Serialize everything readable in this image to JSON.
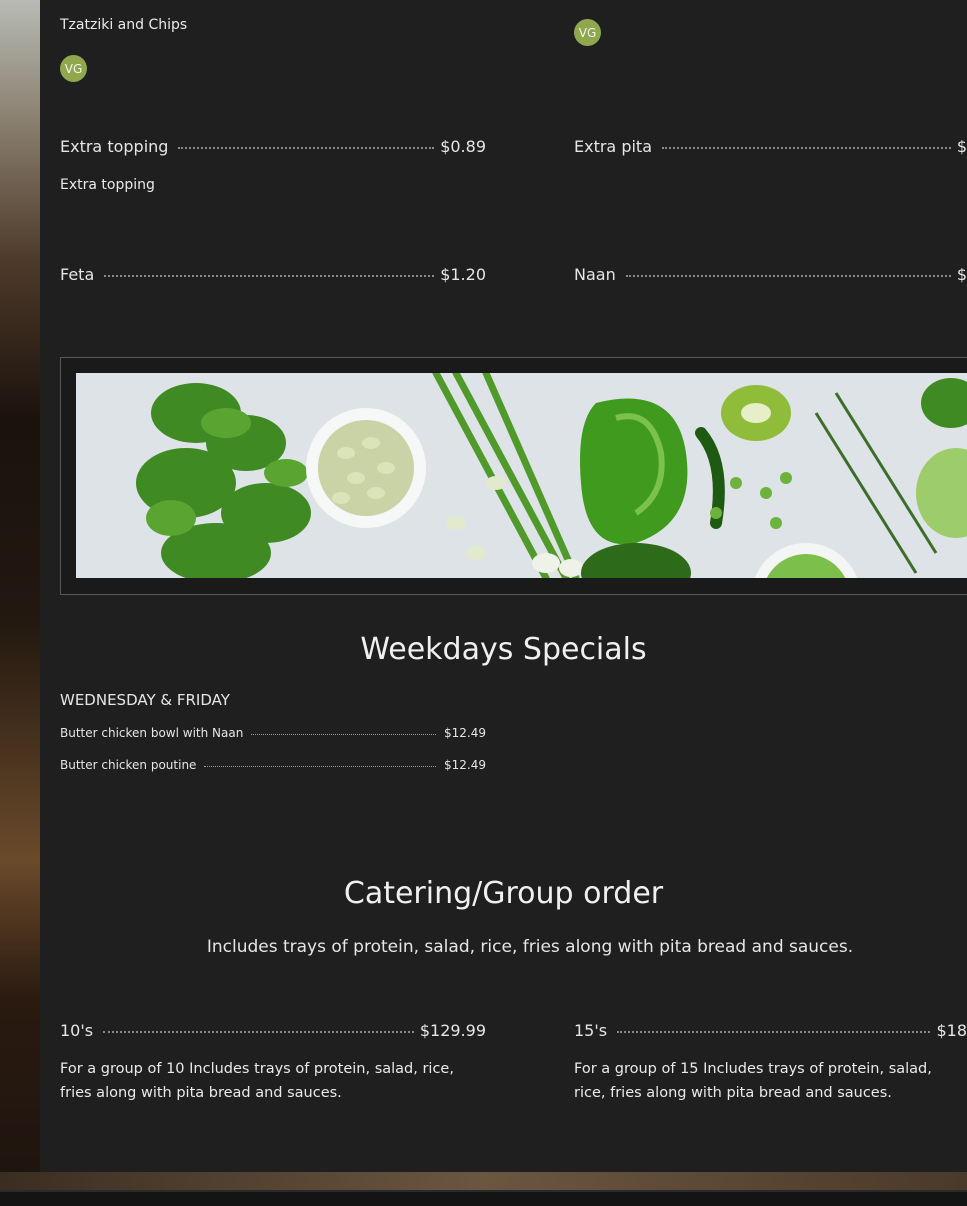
{
  "left_column": {
    "top_item_desc": "Tzatziki and Chips",
    "top_badge": "VG",
    "extra_topping": {
      "name": "Extra topping",
      "price": "$0.89",
      "desc": "Extra topping"
    },
    "feta": {
      "name": "Feta",
      "price": "$1.20"
    }
  },
  "right_column": {
    "top_badge": "VG",
    "extra_pita": {
      "name": "Extra pita",
      "price": "$"
    },
    "naan": {
      "name": "Naan",
      "price": "$"
    }
  },
  "banner_image": {
    "icon": "vegetables-banner-image",
    "palette": [
      "#3e7d22",
      "#6fae3a",
      "#a7c97a",
      "#e4e8ea"
    ]
  },
  "weekdays": {
    "title": "Weekdays Specials",
    "subtitle": "WEDNESDAY & FRIDAY",
    "items": [
      {
        "name": "Butter chicken bowl with Naan",
        "price": "$12.49"
      },
      {
        "name": "Butter chicken poutine",
        "price": "$12.49"
      }
    ]
  },
  "catering": {
    "title": "Catering/Group order",
    "intro": "Includes trays of protein, salad, rice, fries along with pita bread and sauces.",
    "options": [
      {
        "name": "10's",
        "price": "$129.99",
        "desc": "For a group of 10 Includes trays of protein, salad, rice, fries along with pita bread and sauces."
      },
      {
        "name": "15's",
        "price": "$18",
        "desc": "For a group of 15 Includes trays of protein, salad, rice, fries along with pita bread and sauces."
      }
    ]
  },
  "colors": {
    "panel": "#1f1f1f",
    "badge": "#8fa84e",
    "text": "#e8e8e8"
  }
}
